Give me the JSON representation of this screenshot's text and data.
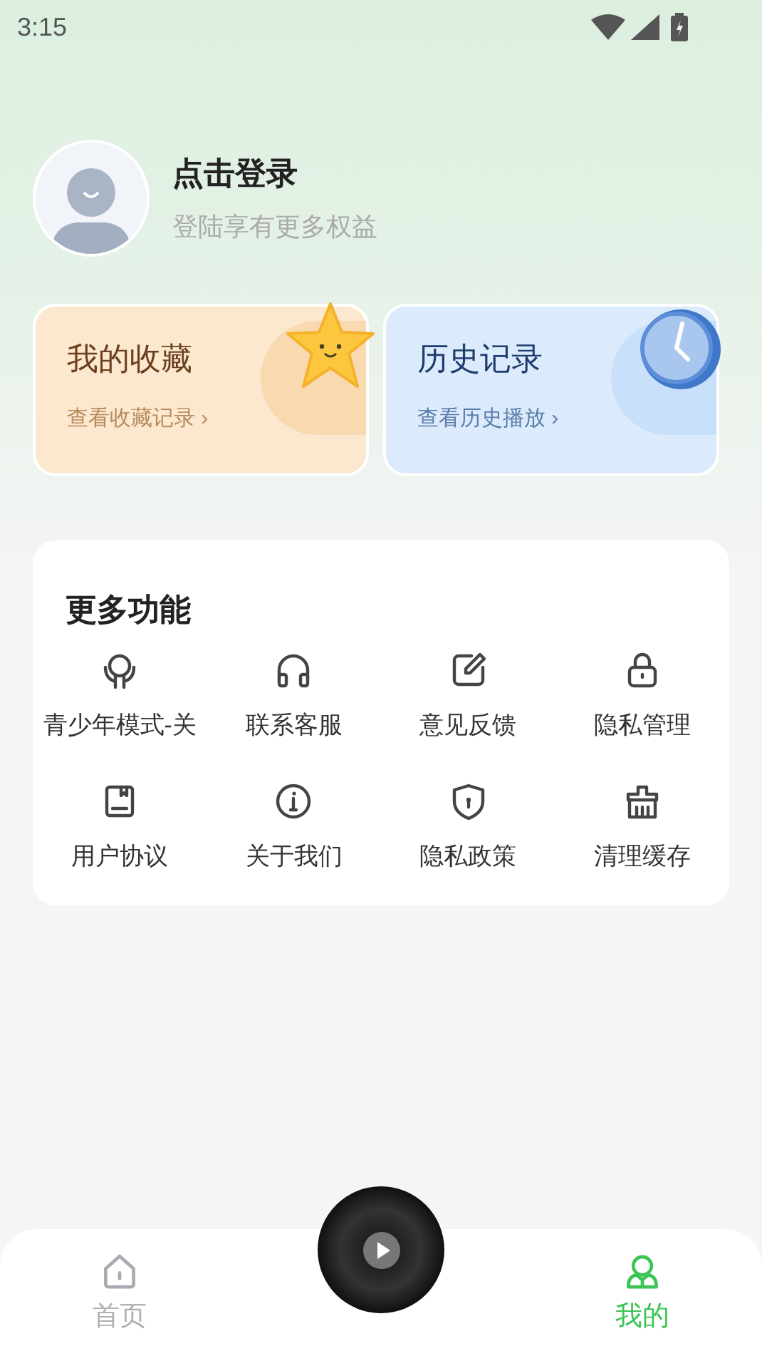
{
  "status_bar": {
    "time": "3:15"
  },
  "profile": {
    "title": "点击登录",
    "subtitle": "登陆享有更多权益"
  },
  "cards": [
    {
      "title": "我的收藏",
      "link": "查看收藏记录 ›"
    },
    {
      "title": "历史记录",
      "link": "查看历史播放 ›"
    }
  ],
  "more": {
    "title": "更多功能",
    "items": [
      {
        "label": "青少年模式-关"
      },
      {
        "label": "联系客服"
      },
      {
        "label": "意见反馈"
      },
      {
        "label": "隐私管理"
      },
      {
        "label": "用户协议"
      },
      {
        "label": "关于我们"
      },
      {
        "label": "隐私政策"
      },
      {
        "label": "清理缓存"
      }
    ]
  },
  "tab_bar": [
    {
      "label": "首页",
      "selected": false
    },
    {
      "label": "我的",
      "selected": true
    }
  ]
}
